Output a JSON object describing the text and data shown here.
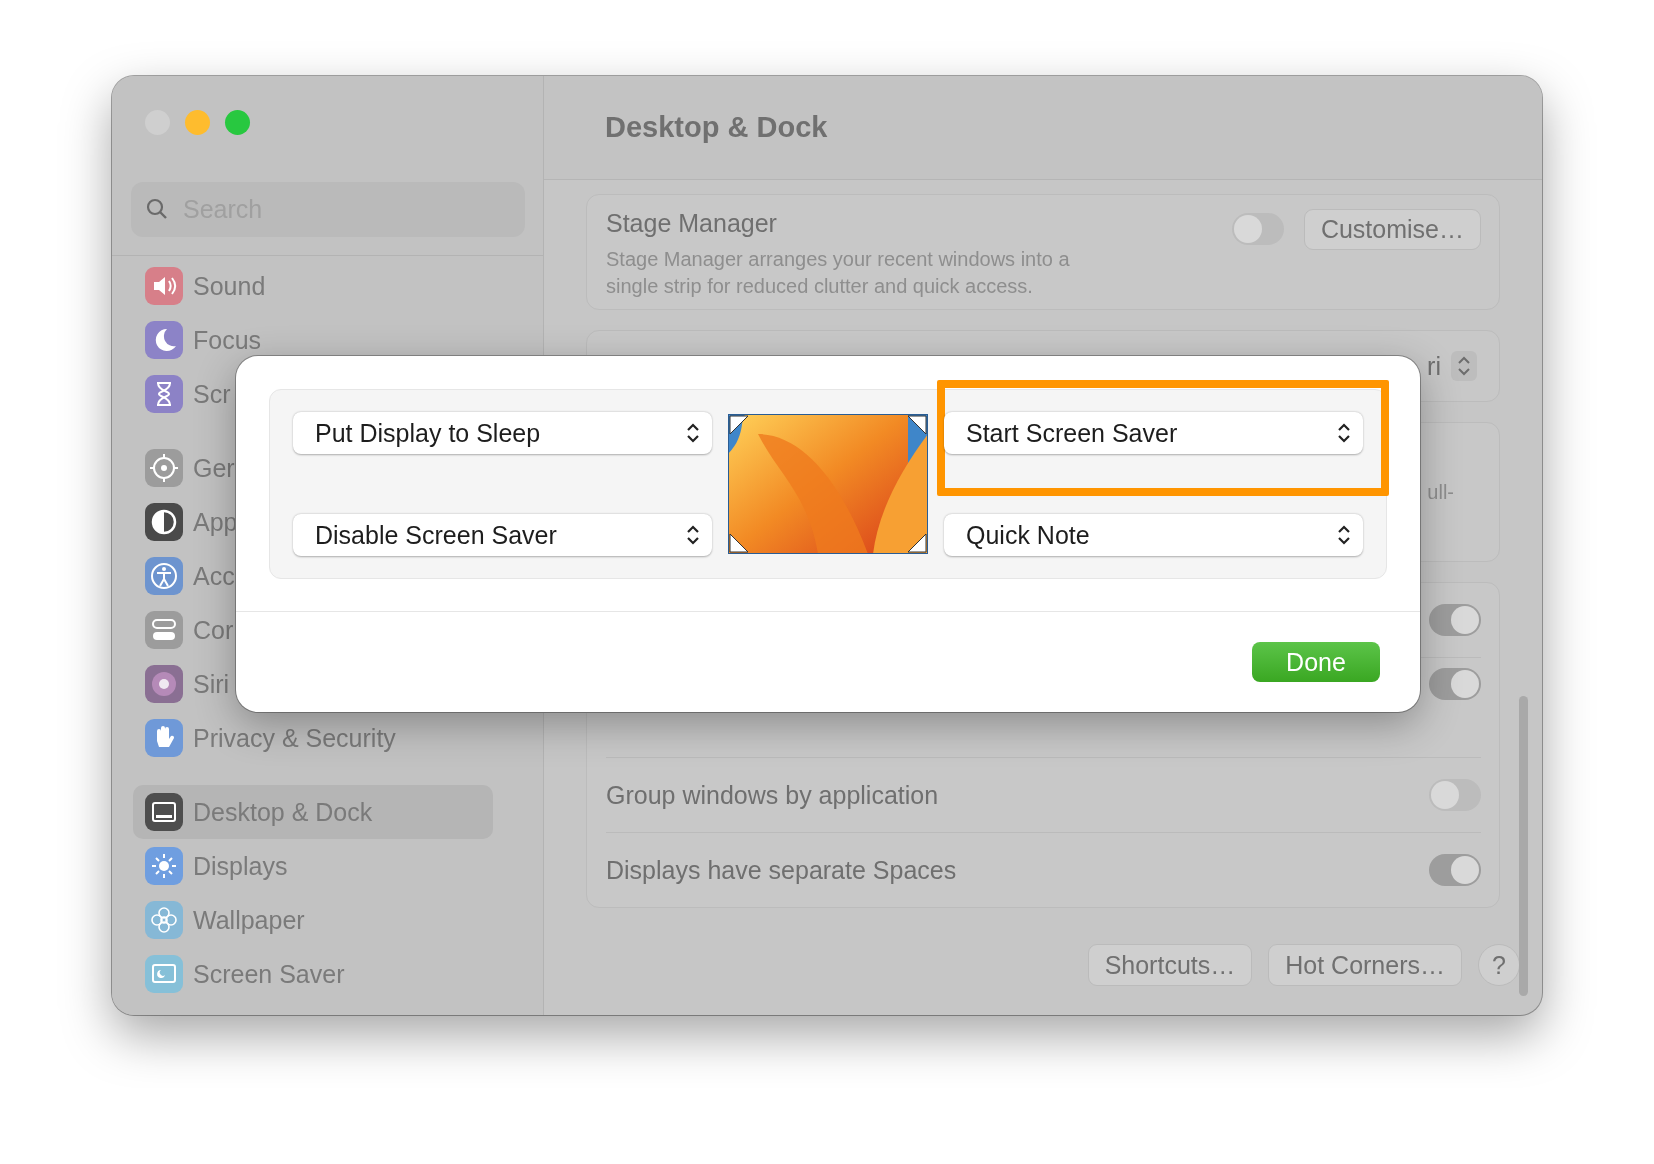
{
  "window": {
    "title": "Desktop & Dock",
    "controls": [
      {
        "color": "#cfcfcf"
      },
      {
        "color": "#febc2e"
      },
      {
        "color": "#28c840"
      }
    ]
  },
  "sidebar": {
    "search": {
      "placeholder": "Search"
    },
    "groups": [
      {
        "items": [
          {
            "label": "Sound",
            "color": "#d77f89",
            "selected": false
          },
          {
            "label": "Focus",
            "color": "#8c83c7",
            "selected": false
          },
          {
            "label": "Scr",
            "color": "#8c82c6",
            "selected": false
          }
        ]
      },
      {
        "items": [
          {
            "label": "Ger",
            "color": "#9c9c9c",
            "selected": false
          },
          {
            "label": "App",
            "color": "#4a4a4a",
            "selected": false
          },
          {
            "label": "Acc",
            "color": "#6d94cf",
            "selected": false
          },
          {
            "label": "Cor",
            "color": "#9c9c9c",
            "selected": false
          },
          {
            "label": "Siri",
            "color": "#8a6f93",
            "selected": false
          },
          {
            "label": "Privacy & Security",
            "color": "#6f99d8",
            "selected": false
          }
        ]
      },
      {
        "items": [
          {
            "label": "Desktop & Dock",
            "color": "#4e4e4e",
            "selected": true
          },
          {
            "label": "Displays",
            "color": "#6f9ee0",
            "selected": false
          },
          {
            "label": "Wallpaper",
            "color": "#86b8d6",
            "selected": false
          },
          {
            "label": "Screen Saver",
            "color": "#86c0d8",
            "selected": false
          }
        ]
      }
    ]
  },
  "main": {
    "stage_manager": {
      "title": "Stage Manager",
      "description": "Stage Manager arranges your recent windows into a single strip for reduced clutter and quick access.",
      "on": false,
      "button": "Customise…"
    },
    "popup": {
      "value": "ri"
    },
    "cut_label": "ull-",
    "toggles": [
      {
        "on": true
      },
      {
        "on": true
      },
      {
        "label": "Group windows by application",
        "on": false
      },
      {
        "label": "Displays have separate Spaces",
        "on": true
      }
    ],
    "buttons": [
      "Shortcuts…",
      "Hot Corners…",
      "?"
    ]
  },
  "modal": {
    "corners": [
      {
        "value": "Put Display to Sleep",
        "highlighted": false
      },
      {
        "value": "Start Screen Saver",
        "highlighted": true
      },
      {
        "value": "Disable Screen Saver",
        "highlighted": false
      },
      {
        "value": "Quick Note",
        "highlighted": false
      }
    ],
    "button": "Done"
  }
}
